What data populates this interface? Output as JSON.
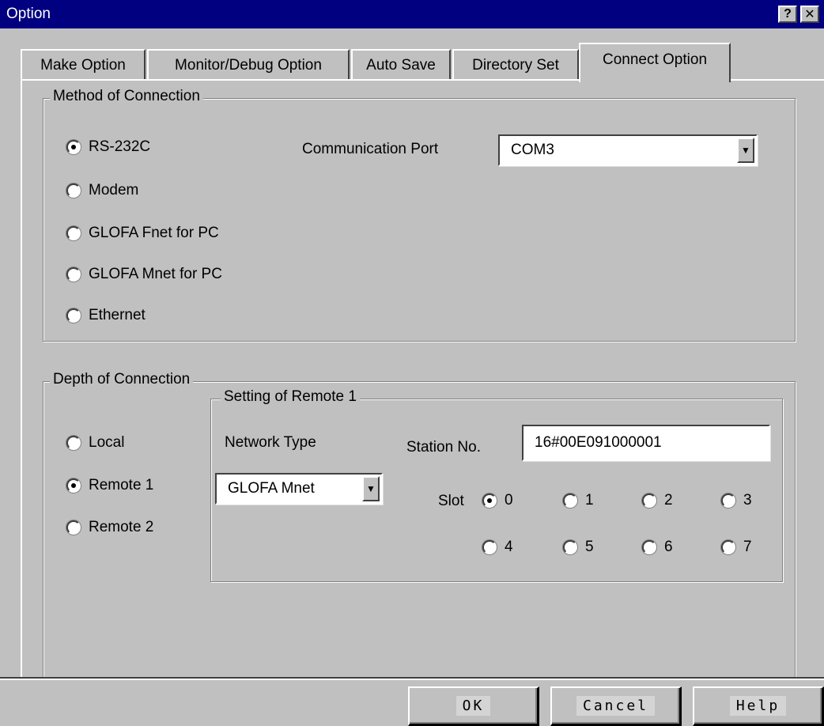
{
  "window": {
    "title": "Option",
    "help_button": "?",
    "close_button": "✕"
  },
  "tabs": [
    {
      "label": "Make Option",
      "active": false
    },
    {
      "label": "Monitor/Debug Option",
      "active": false
    },
    {
      "label": "Auto Save",
      "active": false
    },
    {
      "label": "Directory Set",
      "active": false
    },
    {
      "label": "Connect Option",
      "active": true
    }
  ],
  "method": {
    "legend": "Method of Connection",
    "options": [
      {
        "label": "RS-232C",
        "selected": true
      },
      {
        "label": "Modem",
        "selected": false
      },
      {
        "label": "GLOFA Fnet for PC",
        "selected": false
      },
      {
        "label": "GLOFA Mnet for PC",
        "selected": false
      },
      {
        "label": "Ethernet",
        "selected": false
      }
    ],
    "port_label": "Communication Port",
    "port_value": "COM3"
  },
  "depth": {
    "legend": "Depth of Connection",
    "options": [
      {
        "label": "Local",
        "selected": false
      },
      {
        "label": "Remote 1",
        "selected": true
      },
      {
        "label": "Remote 2",
        "selected": false
      }
    ]
  },
  "remote": {
    "legend": "Setting of Remote 1",
    "network_type_label": "Network Type",
    "network_type_value": "GLOFA Mnet",
    "station_label": "Station No.",
    "station_value": "16#00E091000001",
    "slot_label": "Slot",
    "slots": [
      {
        "label": "0",
        "selected": true
      },
      {
        "label": "1",
        "selected": false
      },
      {
        "label": "2",
        "selected": false
      },
      {
        "label": "3",
        "selected": false
      },
      {
        "label": "4",
        "selected": false
      },
      {
        "label": "5",
        "selected": false
      },
      {
        "label": "6",
        "selected": false
      },
      {
        "label": "7",
        "selected": false
      }
    ]
  },
  "buttons": {
    "ok": "OK",
    "cancel": "Cancel",
    "help": "Help"
  }
}
